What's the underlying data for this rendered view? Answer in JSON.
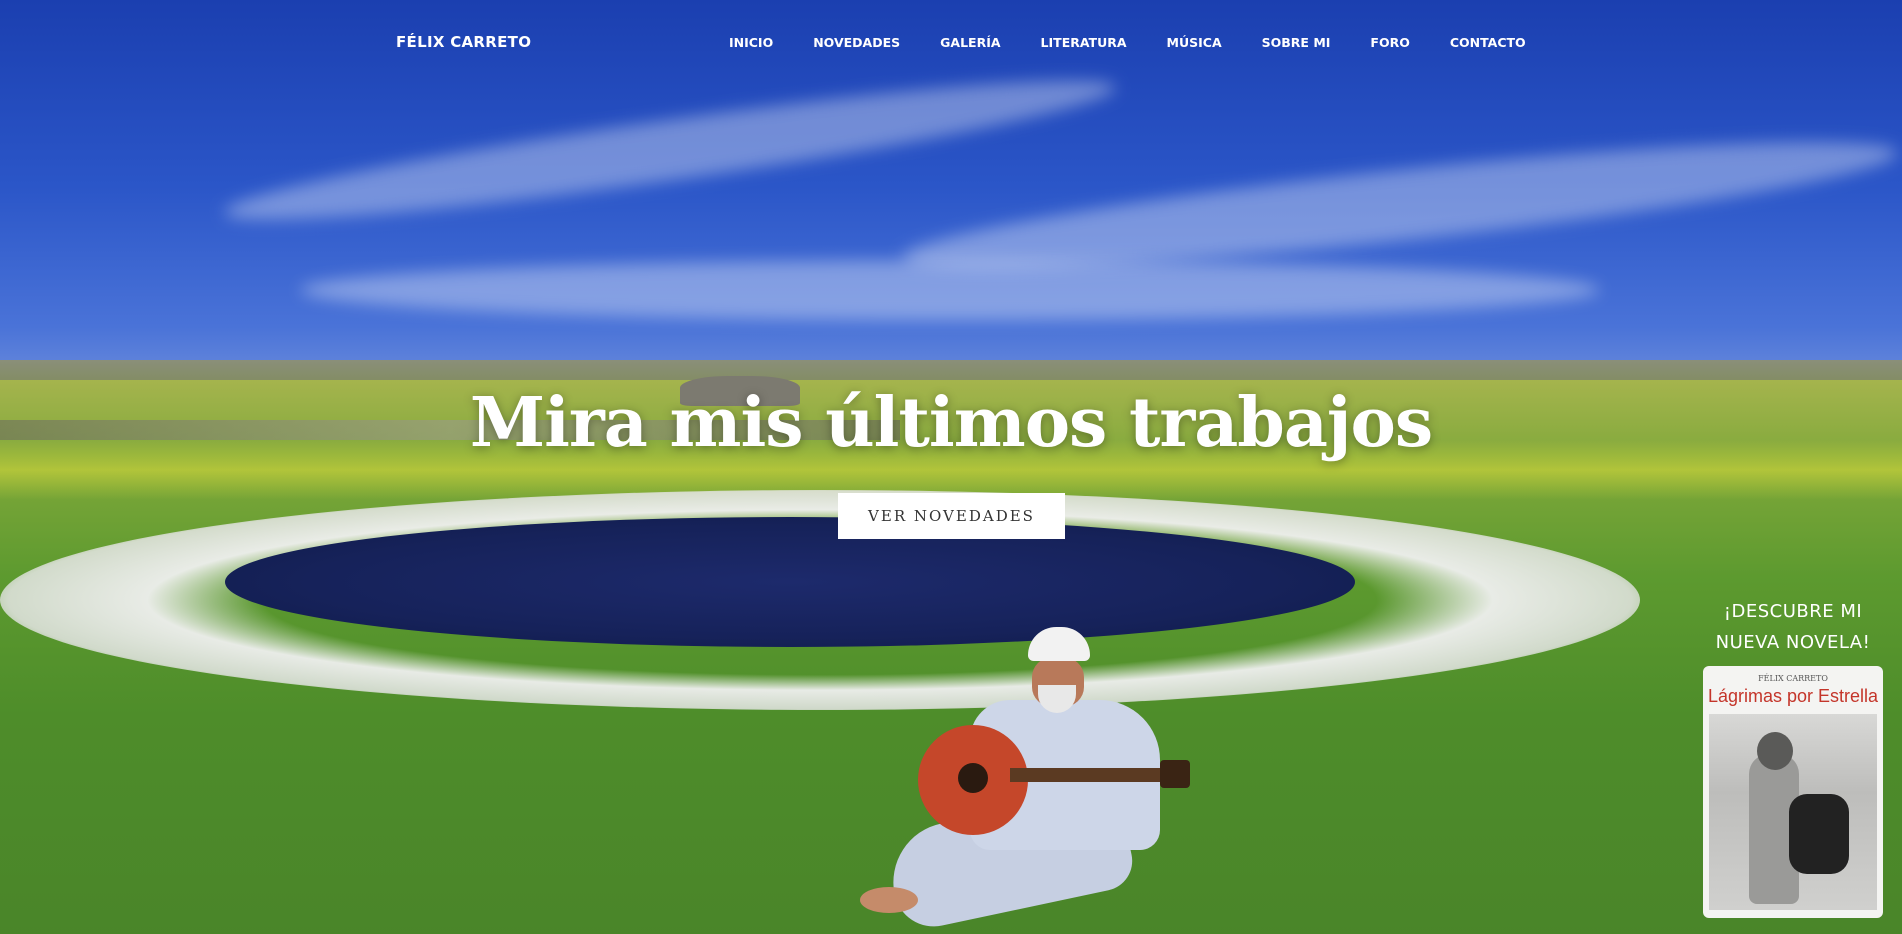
{
  "brand": "FÉLIX CARRETO",
  "nav": {
    "items": [
      "INICIO",
      "NOVEDADES",
      "GALERÍA",
      "LITERATURA",
      "MÚSICA",
      "SOBRE MI",
      "FORO",
      "CONTACTO"
    ]
  },
  "hero": {
    "headline": "Mira mis últimos trabajos",
    "cta_label": "VER NOVEDADES"
  },
  "promo": {
    "line1": "¡DESCUBRE MI",
    "line2": "NUEVA NOVELA!",
    "book_author": "FÉLIX CARRETO",
    "book_title": "Lágrimas por Estrella"
  },
  "colors": {
    "sky": "#2b56c8",
    "grass": "#5d9a2f",
    "cta_background": "#ffffff",
    "book_title": "#c4352a"
  }
}
